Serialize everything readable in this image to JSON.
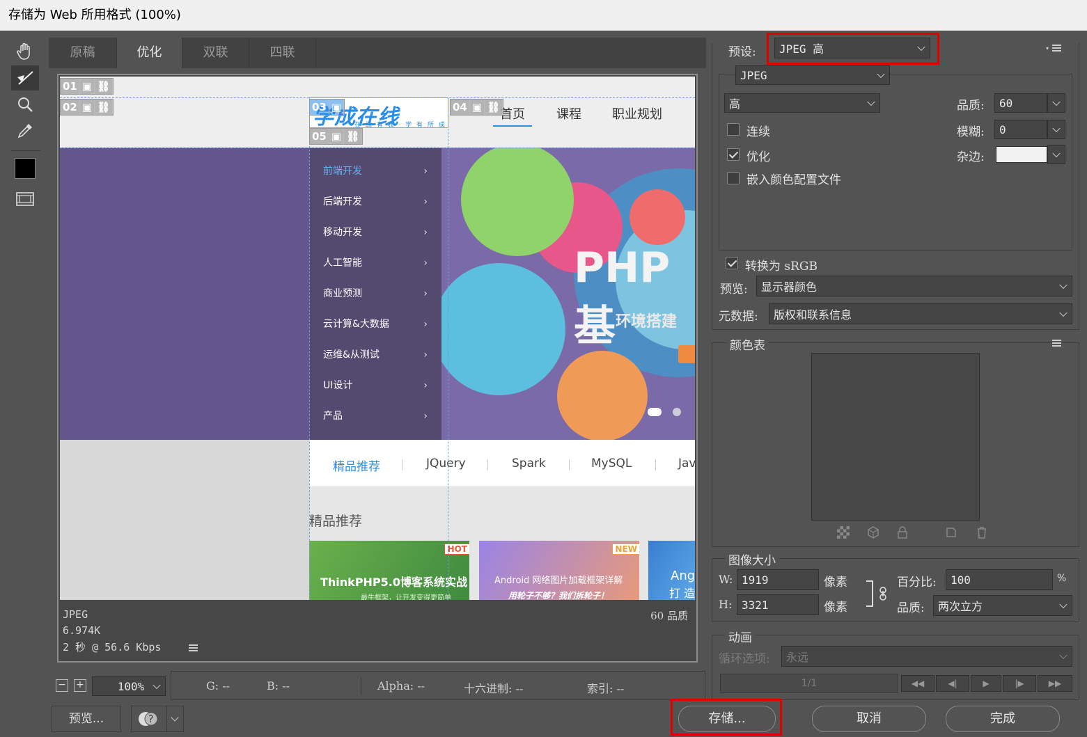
{
  "window": {
    "title": "存储为 Web 所用格式 (100%)"
  },
  "tabs": [
    {
      "label": "原稿"
    },
    {
      "label": "优化"
    },
    {
      "label": "双联"
    },
    {
      "label": "四联"
    }
  ],
  "preview": {
    "slices": [
      "01",
      "02",
      "03",
      "04",
      "05"
    ],
    "site": {
      "logo_text": "学成在线",
      "logo_sub": "在 线 有 我 · 学 有 所 成",
      "nav": [
        "首页",
        "课程",
        "职业规划"
      ],
      "categories": [
        "前端开发",
        "后端开发",
        "移动开发",
        "人工智能",
        "商业预测",
        "云计算&大数据",
        "运维&从测试",
        "UI设计",
        "产品"
      ],
      "banner_title": "PHP基",
      "banner_sub": "环境搭建",
      "tabs": [
        "精品推荐",
        "JQuery",
        "Spark",
        "MySQL",
        "Jav"
      ],
      "section_title": "精品推荐",
      "cards": [
        {
          "badge": "HOT",
          "title": "ThinkPHP5.0博客系统实战",
          "sub": "最牛框架，让开发变得更简单"
        },
        {
          "badge": "NEW",
          "title": "Android 网络图片加载框架详解",
          "sub": "用轮子不够？我们拆轮子！"
        },
        {
          "badge": "",
          "title": "Ang",
          "sub": "打 造"
        }
      ]
    },
    "info": {
      "format": "JPEG",
      "size": "6.974K",
      "time": "2 秒 @ 56.6 Kbps",
      "quality_text": "60 品质"
    }
  },
  "statusbar": {
    "zoom": "100%",
    "g": "G: --",
    "b": "B: --",
    "alpha": "Alpha: --",
    "hex": "十六进制: --",
    "index": "索引: --"
  },
  "bottom_left": {
    "preview_button": "预览..."
  },
  "settings": {
    "preset_label": "预设:",
    "preset_value": "JPEG 高",
    "format_value": "JPEG",
    "quality_level": "高",
    "quality_label": "品质:",
    "quality_value": "60",
    "progressive_label": "连续",
    "progressive_checked": false,
    "blur_label": "模糊:",
    "blur_value": "0",
    "optimized_label": "优化",
    "optimized_checked": true,
    "matte_label": "杂边:",
    "embed_profile_label": "嵌入颜色配置文件",
    "embed_profile_checked": false,
    "convert_srgb_label": "转换为 sRGB",
    "convert_srgb_checked": true,
    "preview_label": "预览:",
    "preview_value": "显示器颜色",
    "metadata_label": "元数据:",
    "metadata_value": "版权和联系信息"
  },
  "color_table": {
    "title": "颜色表"
  },
  "image_size": {
    "title": "图像大小",
    "w_label": "W:",
    "w_value": "1919",
    "h_label": "H:",
    "h_value": "3321",
    "unit": "像素",
    "percent_label": "百分比:",
    "percent_value": "100",
    "percent_unit": "%",
    "quality_label": "品质:",
    "quality_value": "两次立方"
  },
  "animation": {
    "title": "动画",
    "loop_label": "循环选项:",
    "loop_value": "永远",
    "frame": "1/1"
  },
  "buttons": {
    "save": "存储...",
    "cancel": "取消",
    "done": "完成"
  },
  "colors": {
    "red_highlight": "#e00000",
    "site_purple": "#66568e",
    "site_blue": "#2a8de8"
  }
}
